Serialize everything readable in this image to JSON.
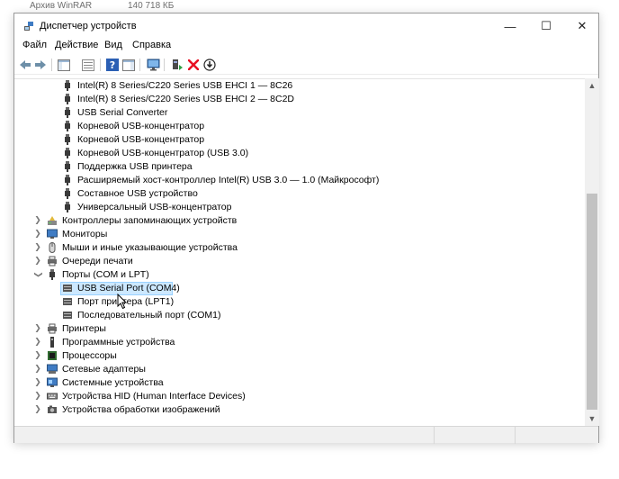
{
  "behind_window": {
    "name": "Архив WinRAR",
    "size": "140 718 КБ"
  },
  "window": {
    "title": "Диспетчер устройств",
    "controls": {
      "minimize": "—",
      "maximize": "☐",
      "close": "✕"
    }
  },
  "menu": {
    "file": "Файл",
    "action": "Действие",
    "view": "Вид",
    "help": "Справка"
  },
  "colors": {
    "selection": "#cce8ff",
    "selection_border": "#99d1ff",
    "delete_red": "#e81123",
    "help_blue": "#2b5fb4"
  },
  "tree": {
    "usb_children": [
      "Intel(R) 8 Series/C220 Series USB EHCI 1 — 8C26",
      "Intel(R) 8 Series/C220 Series USB EHCI 2 — 8C2D",
      "USB Serial Converter",
      "Корневой USB-концентратор",
      "Корневой USB-концентратор",
      "Корневой USB-концентратор (USB 3.0)",
      "Поддержка USB принтера",
      "Расширяемый хост-контроллер Intel(R) USB 3.0 — 1.0 (Майкрософт)",
      "Составное USB устройство",
      "Универсальный USB-концентратор"
    ],
    "storage_controllers": "Контроллеры запоминающих устройств",
    "monitors": "Мониторы",
    "mice": "Мыши и иные указывающие устройства",
    "print_queues": "Очереди печати",
    "ports": "Порты (COM и LPT)",
    "port_children": [
      "USB Serial Port (COM4)",
      "Порт принтера (LPT1)",
      "Последовательный порт (COM1)"
    ],
    "printers": "Принтеры",
    "software_devices": "Программные устройства",
    "processors": "Процессоры",
    "network_adapters": "Сетевые адаптеры",
    "system_devices": "Системные устройства",
    "hid_devices": "Устройства HID (Human Interface Devices)",
    "imaging_devices": "Устройства обработки изображений"
  }
}
